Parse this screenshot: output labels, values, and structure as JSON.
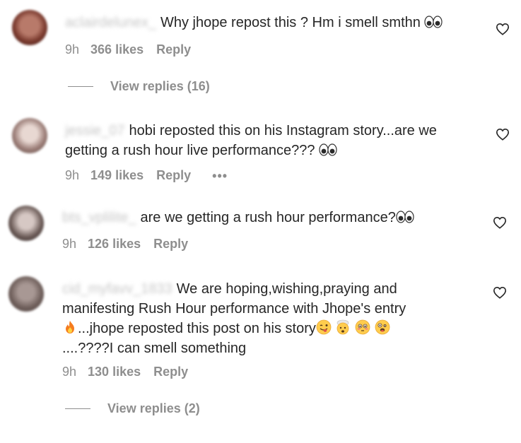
{
  "comments": [
    {
      "username": "aclairdelunex_",
      "text": "Why jhope repost this ? Hm i smell smthn",
      "time": "9h",
      "likes": "366 likes",
      "reply": "Reply",
      "view_replies": "View replies (16)"
    },
    {
      "username": "jessie_07",
      "text": "hobi reposted this on his Instagram story...are we getting a rush hour live performance???",
      "time": "9h",
      "likes": "149 likes",
      "reply": "Reply",
      "more": "•••"
    },
    {
      "username": "bts_vplilite_",
      "text": "are we getting a rush hour performance?",
      "time": "9h",
      "likes": "126 likes",
      "reply": "Reply"
    },
    {
      "username": "cid_myfavv_1833",
      "text_1": "We are hoping,wishing,praying and manifesting Rush Hour performance with Jhope's entry",
      "text_2": "...jhope reposted this post on his story",
      "text_3": "....????I can smell something",
      "time": "9h",
      "likes": "130 likes",
      "reply": "Reply",
      "view_replies": "View replies (2)"
    }
  ],
  "colors": {
    "text": "#262626",
    "secondary": "#8e8e8e"
  },
  "icons": {
    "like": "heart-outline-icon",
    "eyes": "eyes-emoji",
    "fire": "fire-emoji"
  }
}
